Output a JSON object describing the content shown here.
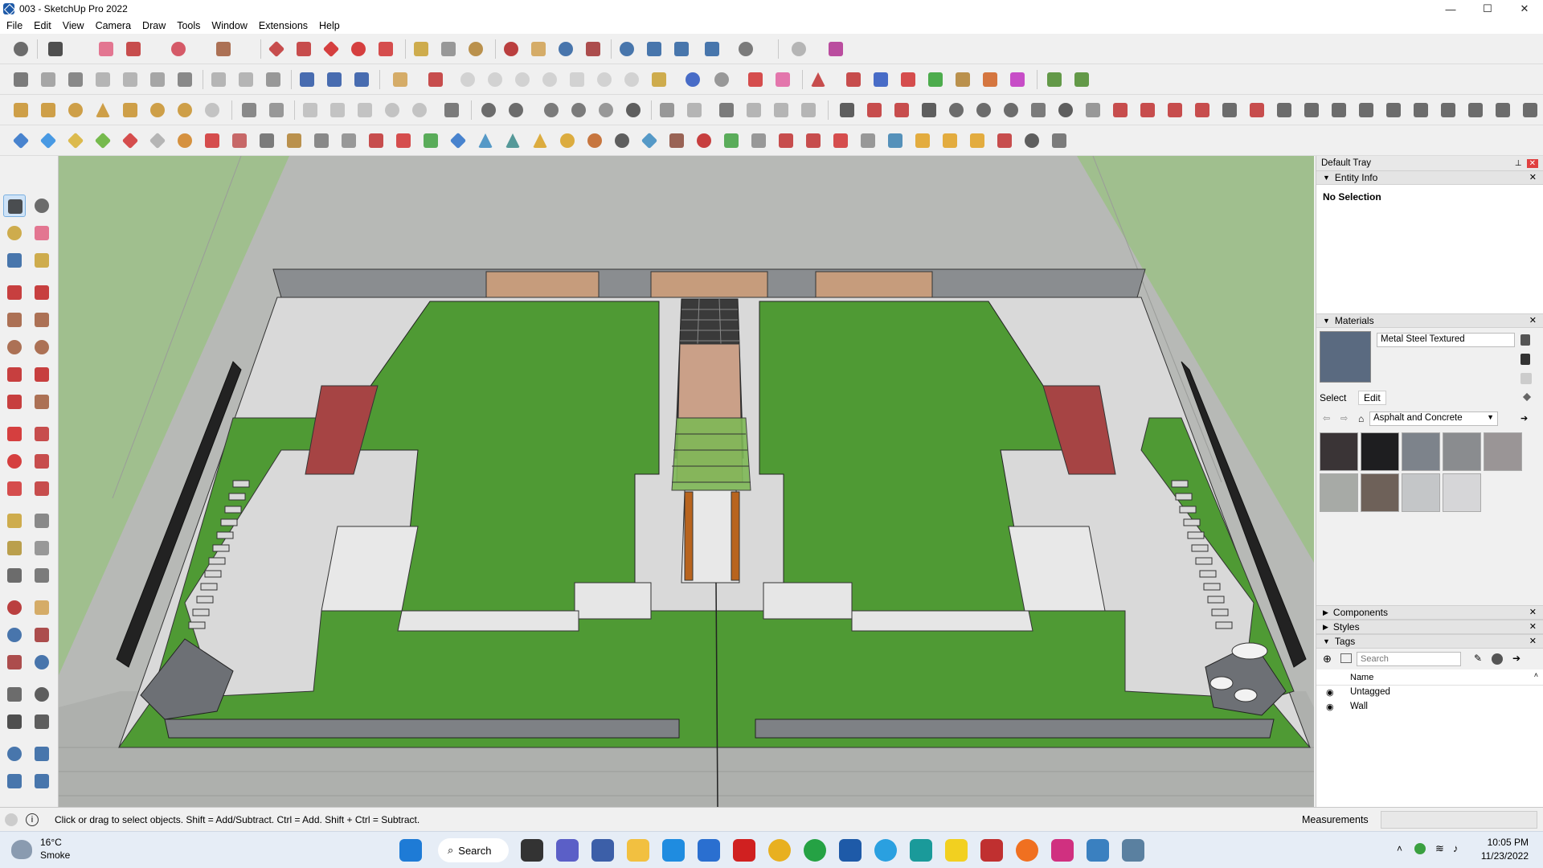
{
  "window": {
    "title": "003 - SketchUp Pro 2022",
    "min": "—",
    "max": "☐",
    "close": "✕"
  },
  "menu": [
    "File",
    "Edit",
    "View",
    "Camera",
    "Draw",
    "Tools",
    "Window",
    "Extensions",
    "Help"
  ],
  "tray": {
    "title": "Default Tray",
    "entity_info": {
      "header": "Entity Info",
      "selection": "No Selection"
    },
    "materials": {
      "header": "Materials",
      "current_material": "Metal Steel Textured",
      "tab_select": "Select",
      "tab_edit": "Edit",
      "library": "Asphalt and Concrete",
      "swatch_colors": [
        "#3a3436",
        "#1e1e20",
        "#7d838b",
        "#8a8c8f",
        "#9a9596",
        "#a7aaa6",
        "#6e6159",
        "#c4c6c8",
        "#d6d6d8"
      ]
    },
    "components": {
      "header": "Components"
    },
    "styles": {
      "header": "Styles"
    },
    "tags": {
      "header": "Tags",
      "search_placeholder": "Search",
      "column_name": "Name",
      "rows": [
        "Untagged",
        "Wall"
      ]
    }
  },
  "status": {
    "message": "Click or drag to select objects. Shift = Add/Subtract. Ctrl = Add. Shift + Ctrl = Subtract.",
    "measurements_label": "Measurements",
    "measurements_value": ""
  },
  "taskbar": {
    "weather_temp": "16°C",
    "weather_desc": "Smoke",
    "search_label": "Search",
    "time": "10:05 PM",
    "date": "11/23/2022"
  }
}
